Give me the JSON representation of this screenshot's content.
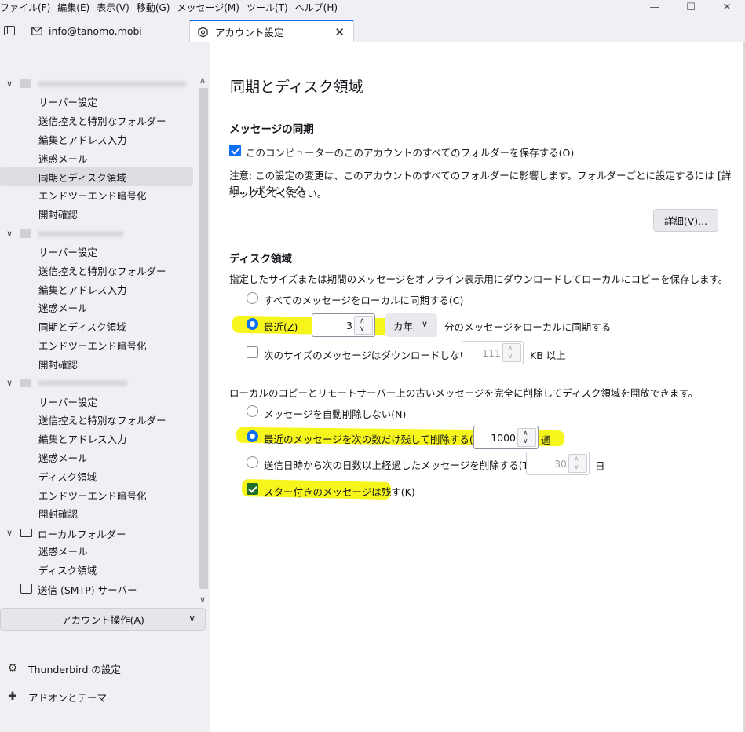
{
  "menu": [
    "ファイル(F)",
    "編集(E)",
    "表示(V)",
    "移動(G)",
    "メッセージ(M)",
    "ツール(T)",
    "ヘルプ(H)"
  ],
  "window_controls": {
    "minimize": "—",
    "maximize": "☐",
    "close": "✕"
  },
  "tabs": {
    "mail_label": "info@tanomo.mobi",
    "active_label": "アカウント設定",
    "close_glyph": "✕"
  },
  "sidebar": {
    "accounts": [
      {
        "label": "",
        "items": [
          "サーバー設定",
          "送信控えと特別なフォルダー",
          "編集とアドレス入力",
          "迷惑メール",
          "同期とディスク領域",
          "エンドツーエンド暗号化",
          "開封確認"
        ]
      },
      {
        "label": "",
        "items": [
          "サーバー設定",
          "送信控えと特別なフォルダー",
          "編集とアドレス入力",
          "迷惑メール",
          "同期とディスク領域",
          "エンドツーエンド暗号化",
          "開封確認"
        ]
      },
      {
        "label": "",
        "items": [
          "サーバー設定",
          "送信控えと特別なフォルダー",
          "編集とアドレス入力",
          "迷惑メール",
          "ディスク領域",
          "エンドツーエンド暗号化",
          "開封確認"
        ]
      },
      {
        "label": "ローカルフォルダー",
        "items": [
          "迷惑メール",
          "ディスク領域"
        ]
      }
    ],
    "smtp_label": "送信 (SMTP) サーバー",
    "account_actions_label": "アカウント操作(A)",
    "settings_link": "Thunderbird の設定",
    "addons_link": "アドオンとテーマ"
  },
  "main": {
    "title": "同期とディスク領域",
    "sync": {
      "heading": "メッセージの同期",
      "keep_all_label": "このコンピューターのこのアカウントのすべてのフォルダーを保存する(O)",
      "keep_all_checked": true,
      "note_line1": "注意: この設定の変更は、このアカウントのすべてのフォルダーに影響します。フォルダーごとに設定するには [詳細...] ボタンをク",
      "note_line2": "リックしてください。",
      "advanced_button": "詳細(V)..."
    },
    "disk": {
      "heading": "ディスク領域",
      "desc": "指定したサイズまたは期間のメッセージをオフライン表示用にダウンロードしてローカルにコピーを保存します。",
      "sync_all_label": "すべてのメッセージをローカルに同期する(C)",
      "recent_label": "最近(Z)",
      "recent_value": "3",
      "recent_unit": "カ年",
      "recent_suffix": "分のメッセージをローカルに同期する",
      "size_limit_label": "次のサイズのメッセージはダウンロードしない(M):",
      "size_limit_value": "111",
      "size_limit_unit": "KB 以上",
      "delete_desc": "ローカルのコピーとリモートサーバー上の古いメッセージを完全に削除してディスク領域を開放できます。",
      "no_delete_label": "メッセージを自動削除しない(N)",
      "keep_recent_label": "最近のメッセージを次の数だけ残して削除する(B)",
      "keep_recent_value": "1000",
      "keep_recent_unit": "通",
      "delete_older_label": "送信日時から次の日数以上経過したメッセージを削除する(T)",
      "delete_older_value": "30",
      "delete_older_unit": "日",
      "keep_starred_label": "スター付きのメッセージは残す(K)",
      "keep_starred_checked": true
    }
  },
  "colors": {
    "accent": "#0b6ef4",
    "highlight": "#f5f510"
  }
}
